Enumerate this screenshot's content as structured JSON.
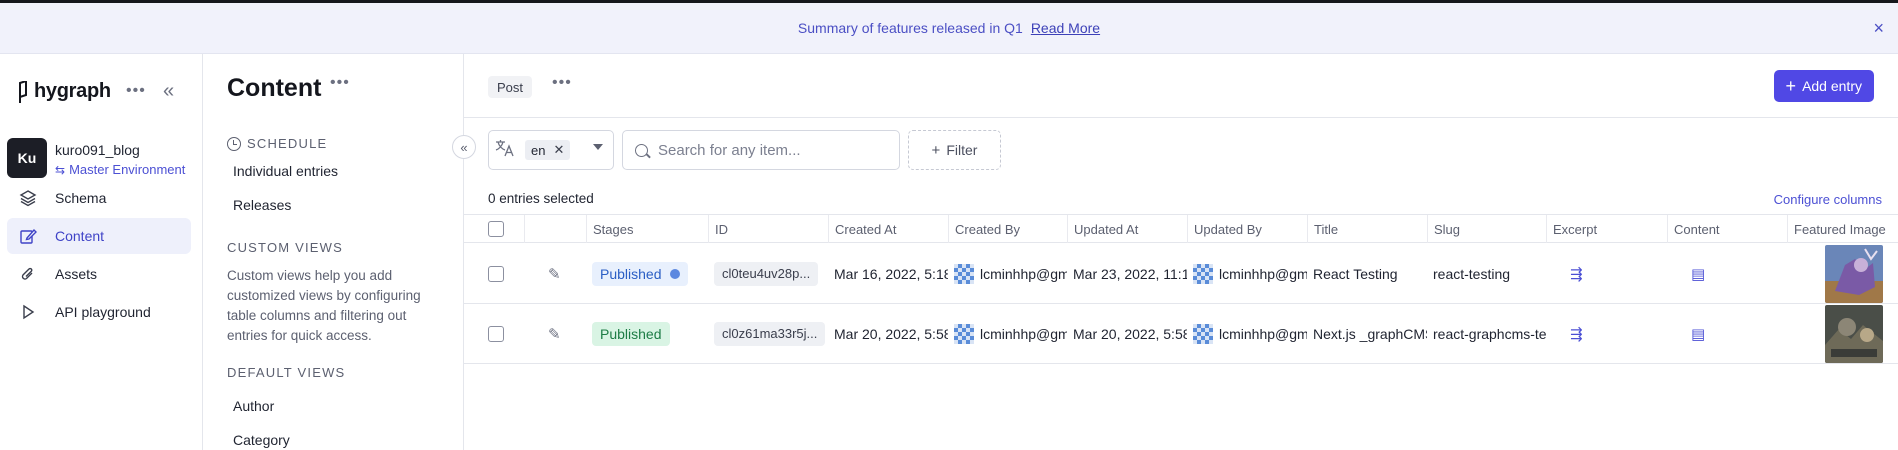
{
  "banner": {
    "text": "Summary of features released in Q1",
    "link": "Read More",
    "close": "×"
  },
  "nav": {
    "logo_text": "hygraph",
    "dots": "•••",
    "collapse": "«",
    "project": {
      "initials": "Ku",
      "name": "kuro091_blog",
      "environment": "Master Environment"
    },
    "items": [
      {
        "label": "Schema",
        "icon": "layers-icon"
      },
      {
        "label": "Content",
        "icon": "edit-icon",
        "active": true
      },
      {
        "label": "Assets",
        "icon": "paperclip-icon"
      },
      {
        "label": "API playground",
        "icon": "play-icon"
      }
    ]
  },
  "content_sidebar": {
    "title": "Content",
    "dots": "•••",
    "schedule_heading": "SCHEDULE",
    "schedule_links": [
      "Individual entries",
      "Releases"
    ],
    "custom_heading": "CUSTOM VIEWS",
    "custom_desc": "Custom views help you add customized views by configuring table columns and filtering out entries for quick access.",
    "default_heading": "DEFAULT VIEWS",
    "default_links": [
      "Author",
      "Category"
    ],
    "toggle": "«"
  },
  "main": {
    "model": "Post",
    "dots": "•••",
    "add_entry": "Add entry",
    "locale": {
      "value": "en"
    },
    "search": {
      "placeholder": "Search for any item..."
    },
    "filter": "Filter",
    "selected_text": "0 entries selected",
    "configure": "Configure columns"
  },
  "table": {
    "columns": [
      "Stages",
      "ID",
      "Created At",
      "Created By",
      "Updated At",
      "Updated By",
      "Title",
      "Slug",
      "Excerpt",
      "Content",
      "Featured Image"
    ],
    "rows": [
      {
        "stage": "Published",
        "stage_style": "blue",
        "id": "cl0teu4uv28p...",
        "created_at": "Mar 16, 2022, 5:18",
        "created_by": "lcminhhp@gm",
        "updated_at": "Mar 23, 2022, 11:1",
        "updated_by": "lcminhhp@gm",
        "title": "React Testing",
        "slug": "react-testing"
      },
      {
        "stage": "Published",
        "stage_style": "green",
        "id": "cl0z61ma33r5j...",
        "created_at": "Mar 20, 2022, 5:58",
        "created_by": "lcminhhp@gm",
        "updated_at": "Mar 20, 2022, 5:58",
        "updated_by": "lcminhhp@gm",
        "title": "Next.js _graphCMS",
        "slug": "react-graphcms-te"
      }
    ]
  },
  "colors": {
    "accent": "#5048e5",
    "banner_bg": "#f1f2fb",
    "published_blue": "#e8f0fd",
    "published_green": "#d9f4e4"
  }
}
